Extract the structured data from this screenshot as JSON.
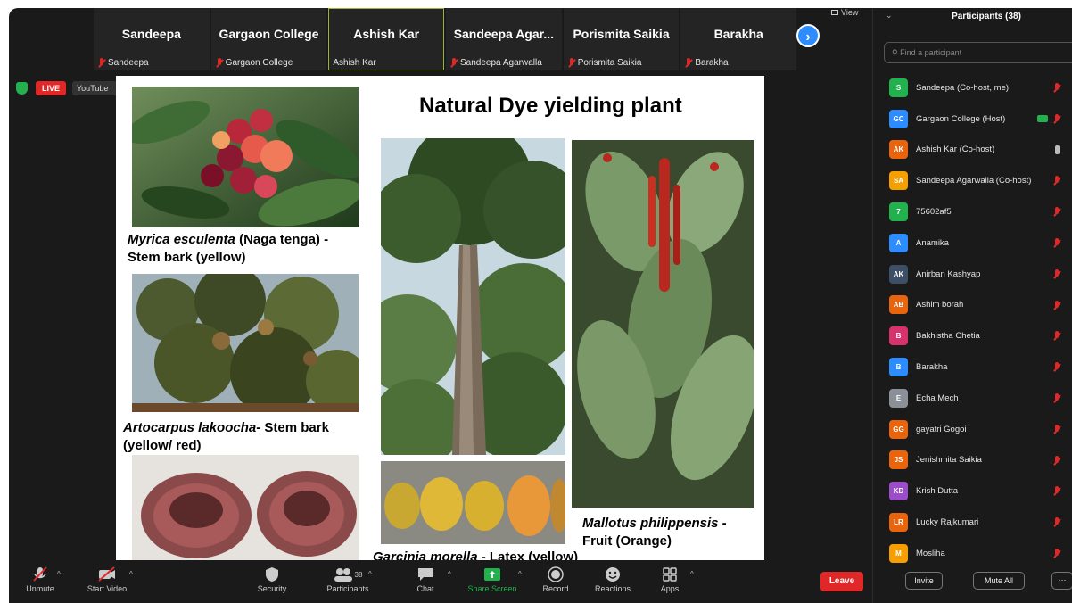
{
  "strip": {
    "tiles": [
      {
        "name": "Sandeepa",
        "label": "Sandeepa"
      },
      {
        "name": "Gargaon College",
        "label": "Gargaon College"
      },
      {
        "name": "Ashish Kar",
        "label": "Ashish Kar"
      },
      {
        "name": "Sandeepa  Agar...",
        "label": "Sandeepa Agarwalla"
      },
      {
        "name": "Porismita Saikia",
        "label": "Porismita Saikia"
      },
      {
        "name": "Barakha",
        "label": "Barakha"
      }
    ],
    "view_label": "View",
    "next_glyph": "›"
  },
  "badges": {
    "live": "LIVE",
    "youtube": "YouTube"
  },
  "slide": {
    "title": "Natural Dye yielding plant",
    "captions": {
      "myrica_species": "Myrica esculenta",
      "myrica_detail": " (Naga tenga) -",
      "myrica_line2": "Stem bark (yellow)",
      "artocarpus_species": "Artocarpus lakoocha",
      "artocarpus_detail": "- Stem bark",
      "artocarpus_line2": "(yellow/ red)",
      "garcinia_species": "Garcinia morella",
      "garcinia_detail": " - Latex (yellow)",
      "mallotus_species": "Mallotus philippensis",
      "mallotus_detail": " -",
      "mallotus_line2": "Fruit (Orange)"
    }
  },
  "panel": {
    "title": "Participants (38)",
    "search_placeholder": "Find a participant",
    "participants": [
      {
        "initials": "S",
        "name": "Sandeepa (Co-host, me)",
        "color": "#23b14d"
      },
      {
        "initials": "GC",
        "name": "Gargaon College (Host)",
        "color": "#2d8cff"
      },
      {
        "initials": "AK",
        "name": "Ashish Kar (Co-host)",
        "color": "#e8650e"
      },
      {
        "initials": "SA",
        "name": "Sandeepa Agarwalla (Co-host)",
        "color": "#f5a000"
      },
      {
        "initials": "7",
        "name": "75602af5",
        "color": "#23b14d"
      },
      {
        "initials": "A",
        "name": "Anamika",
        "color": "#2d8cff"
      },
      {
        "initials": "AK",
        "name": "Anirban Kashyap",
        "color": "#3d4f66"
      },
      {
        "initials": "AB",
        "name": "Ashim borah",
        "color": "#e8650e"
      },
      {
        "initials": "B",
        "name": "Bakhistha Chetia",
        "color": "#d6336c"
      },
      {
        "initials": "B",
        "name": "Barakha",
        "color": "#2d8cff"
      },
      {
        "initials": "E",
        "name": "Echa Mech",
        "color": "#8a8f98"
      },
      {
        "initials": "GG",
        "name": "gayatri Gogoi",
        "color": "#e8650e"
      },
      {
        "initials": "JS",
        "name": "Jenishmita Saikia",
        "color": "#e8650e"
      },
      {
        "initials": "KD",
        "name": "Krish Dutta",
        "color": "#9b4dca"
      },
      {
        "initials": "LR",
        "name": "Lucky Rajkumari",
        "color": "#e8650e"
      },
      {
        "initials": "M",
        "name": "Mosliha",
        "color": "#f5a000"
      }
    ],
    "invite_label": "Invite",
    "muteall_label": "Mute All",
    "more_label": "···"
  },
  "toolbar": {
    "unmute": "Unmute",
    "start_video": "Start Video",
    "security": "Security",
    "participants": "Participants",
    "participants_count": "38",
    "chat": "Chat",
    "share_screen": "Share Screen",
    "record": "Record",
    "reactions": "Reactions",
    "apps": "Apps",
    "leave": "Leave"
  }
}
